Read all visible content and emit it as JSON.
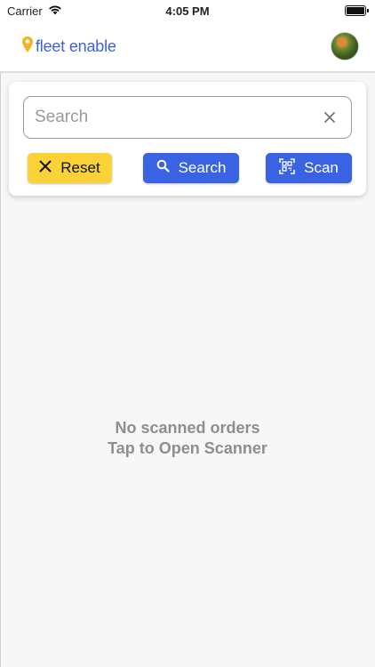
{
  "status_bar": {
    "carrier": "Carrier",
    "time": "4:05 PM",
    "wifi_icon": "wifi-icon",
    "battery_icon": "battery-icon"
  },
  "header": {
    "brand_name": "fleet enable",
    "logo_icon": "map-pin-icon",
    "brand_color": "#3e63d8",
    "logo_color": "#f4b324",
    "avatar_icon": "user-avatar"
  },
  "search": {
    "placeholder": "Search",
    "value": "",
    "clear_icon": "close-icon"
  },
  "buttons": {
    "reset_label": "Reset",
    "reset_color": "#fbd338",
    "search_label": "Search",
    "search_color": "#3a63e3",
    "scan_label": "Scan",
    "scan_color": "#3a63e3"
  },
  "empty_state": {
    "line1": "No scanned orders",
    "line2": "Tap to Open Scanner"
  }
}
